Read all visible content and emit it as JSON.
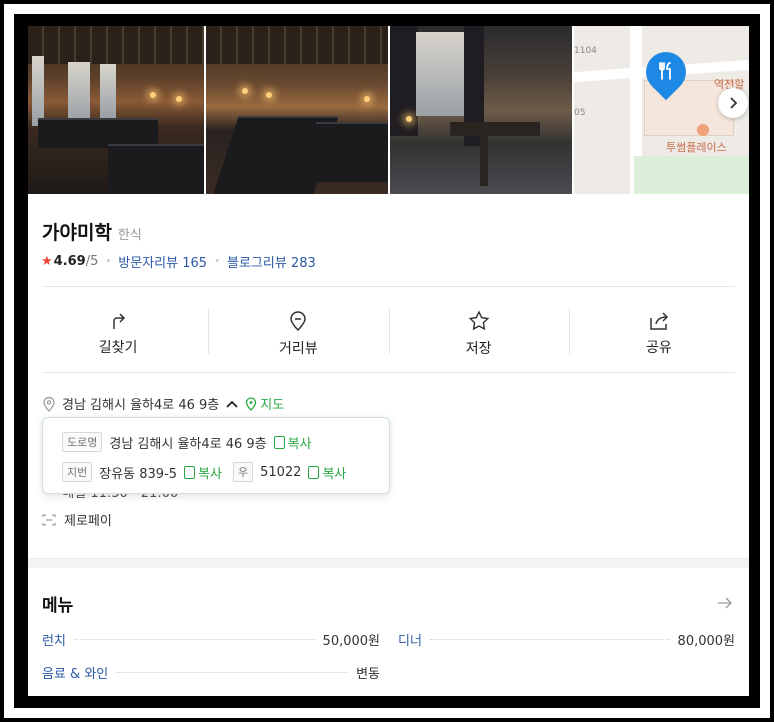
{
  "place": {
    "name": "가야미학",
    "category": "한식",
    "rating_value": "4.69",
    "rating_den": "/5",
    "visitor_reviews_label": "방문자리뷰",
    "visitor_reviews_count": "165",
    "blog_reviews_label": "블로그리뷰",
    "blog_reviews_count": "283"
  },
  "map": {
    "label_station": "역전할",
    "label_twosome": "투썸플레이스",
    "label_num1": "1104",
    "label_num2": "05"
  },
  "actions": [
    {
      "label": "길찾기",
      "icon": "directions-icon"
    },
    {
      "label": "거리뷰",
      "icon": "street-view-icon"
    },
    {
      "label": "저장",
      "icon": "star-outline-icon"
    },
    {
      "label": "공유",
      "icon": "share-icon"
    }
  ],
  "address": {
    "text": "경남 김해시 율하4로 46 9층",
    "map_link": "지도",
    "road_tag": "도로명",
    "road_value": "경남 김해시 율하4로 46 9층",
    "lot_tag": "지번",
    "lot_value": "장유동 839-5",
    "zip_tag": "우",
    "zip_value": "51022",
    "copy_label": "복사"
  },
  "hidden_line": "매일 11:30 - 21:00",
  "zeropay": "제로페이",
  "menu": {
    "title": "메뉴",
    "items": [
      {
        "name": "런치",
        "price": "50,000원"
      },
      {
        "name": "디너",
        "price": "80,000원"
      },
      {
        "name": "음료 & 와인",
        "price": "변동"
      }
    ]
  }
}
